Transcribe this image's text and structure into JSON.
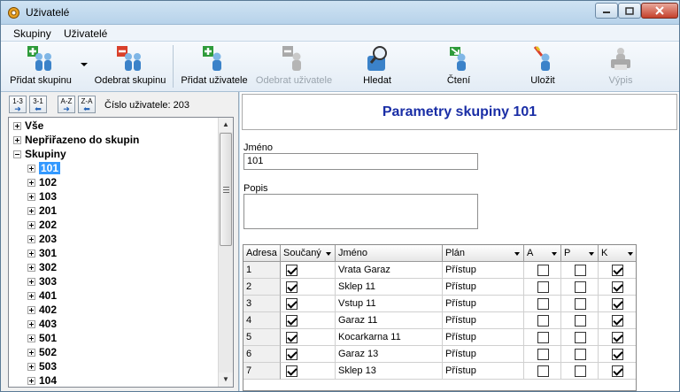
{
  "window": {
    "title": "Uživatelé"
  },
  "menu": [
    {
      "label": "Skupiny"
    },
    {
      "label": "Uživatelé"
    }
  ],
  "toolbar": {
    "add_group": "Přidat skupinu",
    "remove_group": "Odebrat skupinu",
    "add_user": "Přidat uživatele",
    "remove_user": "Odebrat uživatele",
    "search": "Hledat",
    "read": "Čtení",
    "save": "Uložit",
    "print": "Výpis"
  },
  "sort": {
    "btn1": "1-3",
    "btn2": "3-1",
    "btn3": "A-Z",
    "btn4": "Z-A",
    "user_number": "Číslo uživatele: 203"
  },
  "tree": {
    "top": [
      {
        "label": "Vše",
        "state": "collapsed"
      },
      {
        "label": "Nepřiřazeno do skupin",
        "state": "collapsed"
      },
      {
        "label": "Skupiny",
        "state": "expanded"
      }
    ],
    "groups": [
      "101",
      "102",
      "103",
      "201",
      "202",
      "203",
      "301",
      "302",
      "303",
      "401",
      "402",
      "403",
      "501",
      "502",
      "503",
      "104"
    ],
    "selected": "101"
  },
  "detail": {
    "header": "Parametry skupiny 101",
    "name_label": "Jméno",
    "name_value": "101",
    "desc_label": "Popis",
    "desc_value": ""
  },
  "grid": {
    "columns": [
      "Adresa",
      "Součaný",
      "Jméno",
      "Plán",
      "A",
      "P",
      "K"
    ],
    "rows": [
      {
        "addr": "1",
        "member": true,
        "name": "Vrata Garaz",
        "plan": "Přístup",
        "a": false,
        "p": false,
        "k": true
      },
      {
        "addr": "2",
        "member": true,
        "name": "Sklep 11",
        "plan": "Přístup",
        "a": false,
        "p": false,
        "k": true
      },
      {
        "addr": "3",
        "member": true,
        "name": "Vstup 11",
        "plan": "Přístup",
        "a": false,
        "p": false,
        "k": true
      },
      {
        "addr": "4",
        "member": true,
        "name": "Garaz 11",
        "plan": "Přístup",
        "a": false,
        "p": false,
        "k": true
      },
      {
        "addr": "5",
        "member": true,
        "name": "Kocarkarna 11",
        "plan": "Přístup",
        "a": false,
        "p": false,
        "k": true
      },
      {
        "addr": "6",
        "member": true,
        "name": "Garaz 13",
        "plan": "Přístup",
        "a": false,
        "p": false,
        "k": true
      },
      {
        "addr": "7",
        "member": true,
        "name": "Sklep 13",
        "plan": "Přístup",
        "a": false,
        "p": false,
        "k": true
      }
    ]
  },
  "colors": {
    "header_text": "#1a2ea6",
    "selection": "#3399ff",
    "accent_green": "#2e9b3a",
    "accent_red": "#d9402b"
  }
}
